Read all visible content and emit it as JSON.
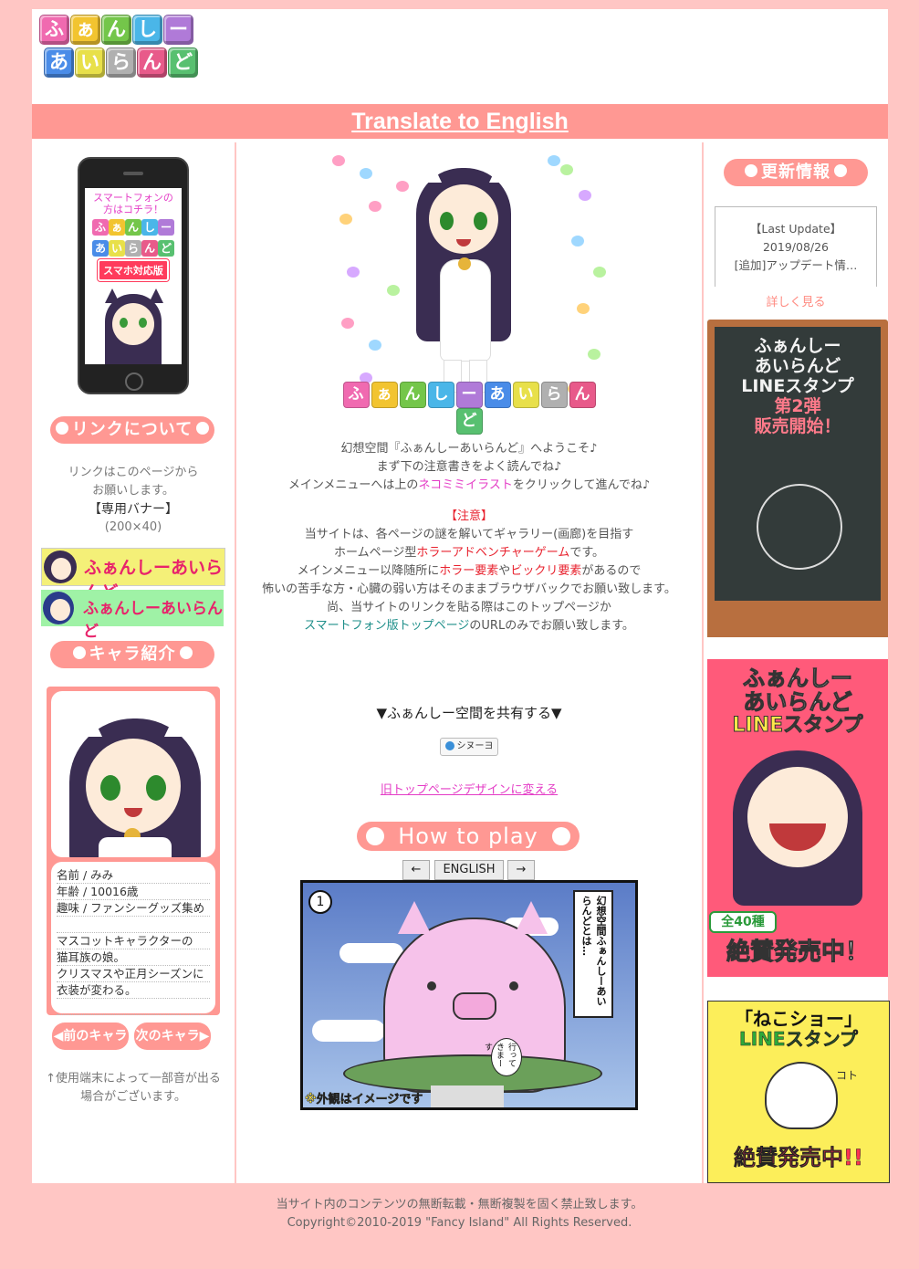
{
  "header": {
    "logo_row1": [
      "ふ",
      "ぁ",
      "ん",
      "し",
      "ー"
    ],
    "logo_row2": [
      "あ",
      "い",
      "ら",
      "ん",
      "ど"
    ],
    "translate_link": "Translate to English"
  },
  "colors": {
    "page_bg": "#ffc6c4",
    "accent": "#ff9893",
    "logo_tiles": [
      "#f06ab0",
      "#f2c430",
      "#74c64a",
      "#4ab6e8",
      "#b07ad8",
      "#4a8ce8",
      "#e8e04a",
      "#b0b0b0",
      "#e85a8a",
      "#58c070"
    ]
  },
  "left": {
    "phone": {
      "line1": "スマートフォンの",
      "line2": "方はコチラ！",
      "tiles_row1": [
        "ふ",
        "ぁ",
        "ん",
        "し",
        "ー"
      ],
      "tiles_row2": [
        "あ",
        "い",
        "ら",
        "ん",
        "ど"
      ],
      "badge": "スマホ対応版"
    },
    "link_heading": "リンクについて",
    "link_text1": "リンクはこのページから",
    "link_text2": "お願いします。",
    "banner_heading": "【専用バナー】",
    "banner_size": "(200×40)",
    "banner1_text": "ふぁんしーあいらんど",
    "banner2_text": "ふぁんしーあいらんど",
    "chara_heading": "キャラ紹介",
    "chara_info": [
      "名前 / みみ",
      "年齢 / 10016歳",
      "趣味 / ファンシーグッズ集め",
      "",
      "マスコットキャラクターの",
      "猫耳族の娘。",
      "クリスマスや正月シーズンに",
      "衣装が変わる。",
      ""
    ],
    "prev_chara": "◀前のキャラ",
    "next_chara": "次のキャラ▶",
    "note1": "↑使用端末によって一部音が出る",
    "note2": "場合がございます。"
  },
  "main": {
    "hero_logo": [
      "ふ",
      "ぁ",
      "ん",
      "し",
      "ー",
      "あ",
      "い",
      "ら",
      "ん",
      "ど"
    ],
    "intro": {
      "l1": "幻想空間『ふぁんしーあいらんど』へようこそ♪",
      "l2": "まず下の注意書きをよく読んでね♪",
      "l3a": "メインメニューへは上の",
      "l3b": "ネコミミイラスト",
      "l3c": "をクリックして進んでね♪",
      "caution": "【注意】",
      "c1": "当サイトは、各ページの謎を解いてギャラリー(画廊)を目指す",
      "c2a": "ホームページ型",
      "c2b": "ホラーアドベンチャーゲーム",
      "c2c": "です。",
      "c3a": "メインメニュー以降随所に",
      "c3b": "ホラー要素",
      "c3c": "や",
      "c3d": "ビックリ要素",
      "c3e": "があるので",
      "c4": "怖いの苦手な方・心臓の弱い方はそのままブラウザバックでお願い致します。",
      "c5": "尚、当サイトのリンクを貼る際はこのトップページか",
      "c6a": "スマートフォン版トップページ",
      "c6b": "のURLのみでお願い致します。"
    },
    "share_label": "▼ふぁんしー空間を共有する▼",
    "share_button": "シヌーヨ",
    "old_design_link": "旧トップページデザインに変える",
    "howto": "How to play",
    "prev": "←",
    "lang": "ENGLISH",
    "next": "→",
    "comic": {
      "panel_num": "1",
      "bubble": "幻想空間ふぁんしーあいらんどとは…",
      "small_bubble": "行ってきまーす",
      "caption": "※外観はイメージです"
    }
  },
  "right": {
    "update_heading": "更新情報",
    "last_update_label": "【Last Update】",
    "last_update_date": "2019/08/26",
    "last_update_item": "[追加]アップデート情…",
    "more": "詳しく見る",
    "ad1": {
      "l1": "ふぁんしー",
      "l2": "あいらんど",
      "l3": "LINEスタンプ",
      "l4": "第2弾",
      "l5": "販売開始！"
    },
    "ad2": {
      "l1": "ふぁんしー",
      "l2": "あいらんど",
      "l3": "LINEスタンプ",
      "badge": "全40種",
      "bottom": "絶賛発売中！"
    },
    "ad3": {
      "l1": "「ねこショー」",
      "l2": "LINEスタンプ",
      "koto": "コト",
      "bottom": "絶賛発売中!!"
    }
  },
  "footer": {
    "l1": "当サイト内のコンテンツの無断転載・無断複製を固く禁止致します。",
    "l2": "Copyright©2010-2019 \"Fancy Island\" All Rights Reserved."
  }
}
